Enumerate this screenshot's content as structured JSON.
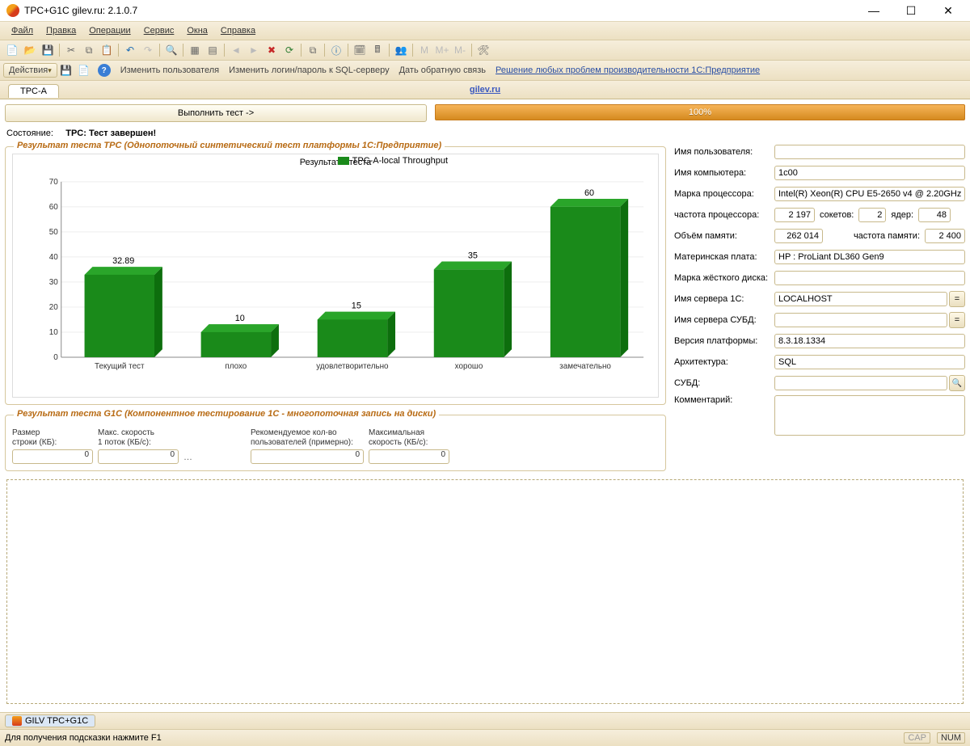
{
  "window": {
    "title": "TPC+G1C gilev.ru: 2.1.0.7"
  },
  "menu": [
    "Файл",
    "Правка",
    "Операции",
    "Сервис",
    "Окна",
    "Справка"
  ],
  "toolbar2": {
    "actions": "Действия",
    "links": [
      "Изменить пользователя",
      "Изменить логин/пароль к SQL-серверу",
      "Дать обратную связь",
      "Решение любых проблем производительности 1С:Предприятие"
    ]
  },
  "tabs": {
    "main": "TPC-A",
    "siteLink": "gilev.ru"
  },
  "runButton": "Выполнить тест ->",
  "progress": "100%",
  "status": {
    "label": "Состояние:",
    "value": "TPC: Тест завершен!"
  },
  "group_tpc": {
    "title": "Результат теста TPC (Однопоточный синтетический тест платформы 1С:Предприятие)",
    "chart_title": "Результаты теста",
    "legend": "TPC-A-local Throughput"
  },
  "chart_data": {
    "type": "bar",
    "categories": [
      "Текущий тест",
      "плохо",
      "удовлетворительно",
      "хорошо",
      "замечательно"
    ],
    "values": [
      32.89,
      10,
      15,
      35,
      60
    ],
    "labels": [
      "32.89",
      "10",
      "15",
      "35",
      "60"
    ],
    "title": "Результаты теста",
    "xlabel": "",
    "ylabel": "",
    "ylim": [
      0,
      70
    ],
    "yticks": [
      0,
      10,
      20,
      30,
      40,
      50,
      60,
      70
    ]
  },
  "group_g1c": {
    "title": "Результат теста G1C (Компонентное тестирование 1С - многопоточная запись на диски)",
    "cols": {
      "rowSize": "Размер\nстроки (КБ):",
      "maxSpeed1": "Макс. скорость\n1 поток (КБ/с):",
      "recUsers": "Рекомендуемое кол-во\nпользователей (примерно):",
      "maxSpeed": "Максимальная\nскорость (КБ/с):"
    },
    "vals": {
      "rowSize": "0",
      "maxSpeed1": "0",
      "recUsers": "0",
      "maxSpeed": "0"
    }
  },
  "info": {
    "labels": {
      "user": "Имя пользователя:",
      "computer": "Имя компьютера:",
      "cpuBrand": "Марка процессора:",
      "cpuFreq": "частота процессора:",
      "sockets": "сокетов:",
      "cores": "ядер:",
      "mem": "Объём памяти:",
      "memFreq": "частота памяти:",
      "mobo": "Материнская плата:",
      "hdd": "Марка жёсткого диска:",
      "srv1c": "Имя сервера 1С:",
      "srvdb": "Имя сервера СУБД:",
      "platform": "Версия платформы:",
      "arch": "Архитектура:",
      "dbms": "СУБД:",
      "comment": "Комментарий:"
    },
    "vals": {
      "user": "",
      "computer": "1c00",
      "cpuBrand": "Intel(R) Xeon(R) CPU E5-2650 v4 @ 2.20GHz",
      "cpuFreq": "2 197",
      "sockets": "2",
      "cores": "48",
      "mem": "262 014",
      "memFreq": "2 400",
      "mobo": "HP : ProLiant DL360 Gen9",
      "hdd": "",
      "srv1c": "LOCALHOST",
      "srvdb": "",
      "platform": "8.3.18.1334",
      "arch": "SQL",
      "dbms": ""
    }
  },
  "footer": {
    "docTab": "GILV TPC+G1C",
    "hint": "Для получения подсказки нажмите F1",
    "cap": "CAP",
    "num": "NUM"
  }
}
